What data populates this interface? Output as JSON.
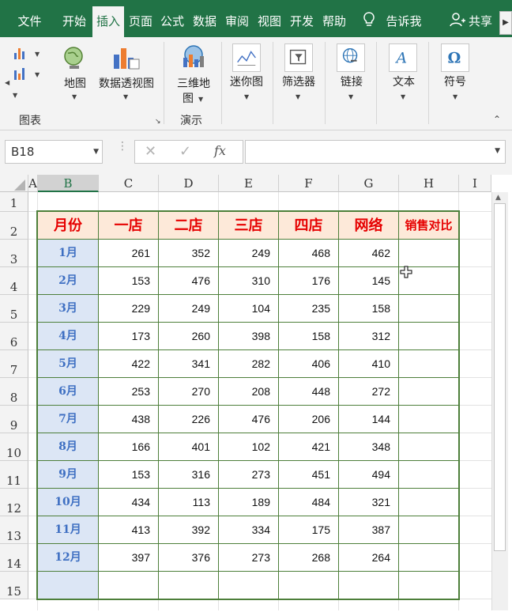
{
  "tabs": [
    {
      "label": "文件"
    },
    {
      "label": "开始"
    },
    {
      "label": "插入"
    },
    {
      "label": "页面"
    },
    {
      "label": "公式"
    },
    {
      "label": "数据"
    },
    {
      "label": "审阅"
    },
    {
      "label": "视图"
    },
    {
      "label": "开发"
    },
    {
      "label": "帮助"
    }
  ],
  "tell_me": "告诉我",
  "share": "共享",
  "ribbon": {
    "map": "地图",
    "pivot_chart": "数据透视图",
    "map3d_line1": "三维地",
    "map3d_line2": "图",
    "sparkline": "迷你图",
    "filter": "筛选器",
    "link": "链接",
    "text": "文本",
    "symbol": "符号",
    "group_charts": "图表",
    "group_tours": "演示"
  },
  "formula_bar": {
    "name_box": "B18",
    "fx": "fx",
    "formula": ""
  },
  "columns": [
    "A",
    "B",
    "C",
    "D",
    "E",
    "F",
    "G",
    "H",
    "I"
  ],
  "rows": [
    "1",
    "2",
    "3",
    "4",
    "5",
    "6",
    "7",
    "8",
    "9",
    "10",
    "11",
    "12",
    "13",
    "14",
    "15"
  ],
  "table": {
    "headers": [
      "月份",
      "一店",
      "二店",
      "三店",
      "四店",
      "网络",
      "销售对比"
    ],
    "months": [
      "1月",
      "2月",
      "3月",
      "4月",
      "5月",
      "6月",
      "7月",
      "8月",
      "9月",
      "10月",
      "11月",
      "12月"
    ],
    "values": [
      [
        "261",
        "352",
        "249",
        "468",
        "462"
      ],
      [
        "153",
        "476",
        "310",
        "176",
        "145"
      ],
      [
        "229",
        "249",
        "104",
        "235",
        "158"
      ],
      [
        "173",
        "260",
        "398",
        "158",
        "312"
      ],
      [
        "422",
        "341",
        "282",
        "406",
        "410"
      ],
      [
        "253",
        "270",
        "208",
        "448",
        "272"
      ],
      [
        "438",
        "226",
        "476",
        "206",
        "144"
      ],
      [
        "166",
        "401",
        "102",
        "421",
        "348"
      ],
      [
        "153",
        "316",
        "273",
        "451",
        "494"
      ],
      [
        "434",
        "113",
        "189",
        "484",
        "321"
      ],
      [
        "413",
        "392",
        "334",
        "175",
        "387"
      ],
      [
        "397",
        "376",
        "273",
        "268",
        "264"
      ]
    ]
  },
  "colors": {
    "accent": "#217346",
    "header_fill": "#fde9d9",
    "header_text": "#e60000",
    "month_fill": "#dce6f5",
    "month_text": "#3e6fc2",
    "table_border": "#4d7f3a"
  }
}
